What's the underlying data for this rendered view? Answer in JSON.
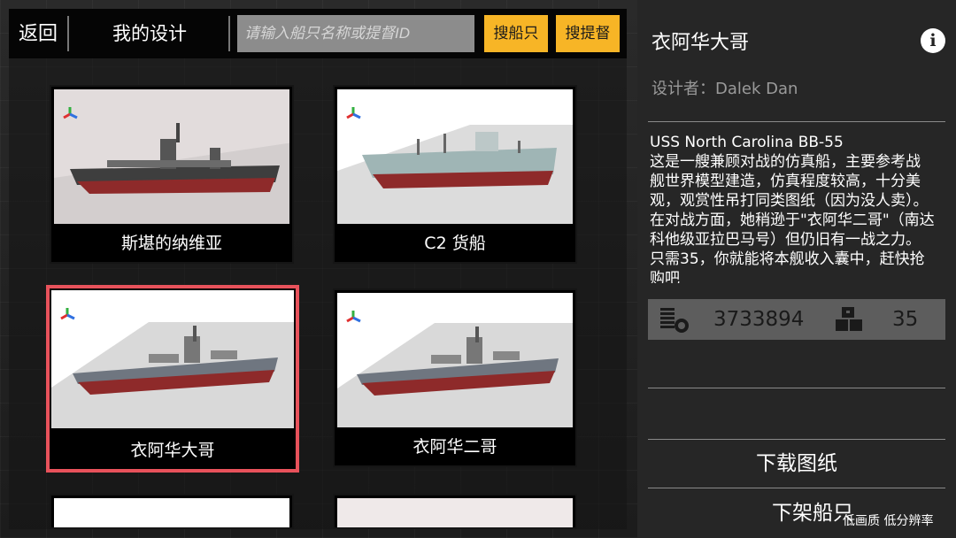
{
  "header": {
    "back_label": "返回",
    "my_designs_label": "我的设计",
    "search_placeholder": "请输入船只名称或提督ID",
    "search_ship_label": "搜船只",
    "search_admiral_label": "搜提督"
  },
  "cards": [
    {
      "label": "斯堪的纳维亚",
      "selected": false
    },
    {
      "label": "C2 货船",
      "selected": false
    },
    {
      "label": "衣阿华大哥",
      "selected": true
    },
    {
      "label": "衣阿华二哥",
      "selected": false
    }
  ],
  "detail": {
    "title": "衣阿华大哥",
    "designer": "设计者：Dalek Dan",
    "description": "USS North Carolina BB-55\n这是一艘兼顾对战的仿真船，主要参考战舰世界模型建造，仿真程度较高，十分美观，观赏性吊打同类图纸（因为没人卖）。在对战方面，她稍逊于\"衣阿华二哥\"（南达科他级亚拉巴马号）但仍旧有一战之力。只需35，你就能将本舰收入囊中，赶快抢购吧",
    "cost": "3733894",
    "price": "35",
    "download_label": "下载图纸",
    "unlist_label": "下架船只",
    "quality_label": "低画质 低分辨率"
  },
  "colors": {
    "accent_yellow": "#f7b526",
    "selected_border": "#e8525b"
  },
  "icons": {
    "info": "info-icon",
    "coins": "coin-stack-icon",
    "crates": "crates-icon",
    "axis": "axis-gizmo-icon"
  }
}
